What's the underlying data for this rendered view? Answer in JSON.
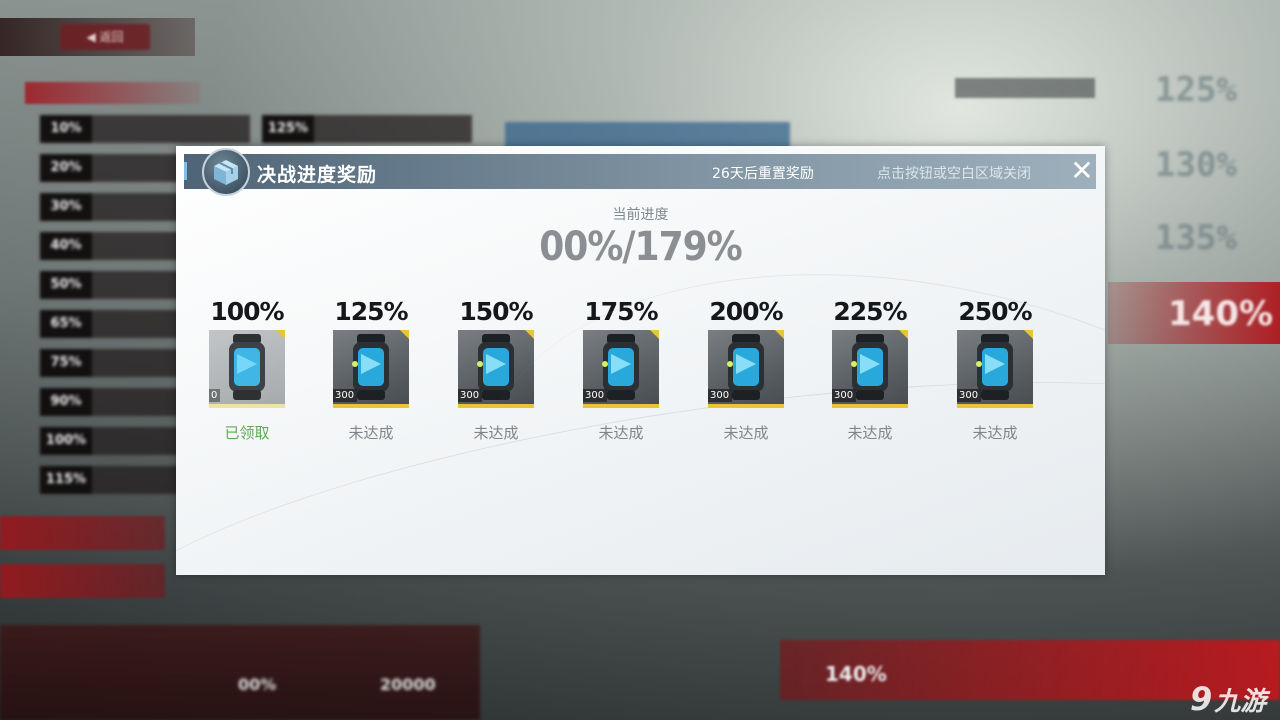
{
  "dialog": {
    "title": "决战进度奖励",
    "reset_text": "26天后重置奖励",
    "close_hint": "点击按钮或空白区域关闭",
    "close_glyph": "✕",
    "progress_label": "当前进度",
    "progress_value": "00%/179%"
  },
  "rewards": [
    {
      "percent": "100%",
      "quantity": "0",
      "status": "已领取",
      "claimed": true
    },
    {
      "percent": "125%",
      "quantity": "300",
      "status": "未达成",
      "claimed": false
    },
    {
      "percent": "150%",
      "quantity": "300",
      "status": "未达成",
      "claimed": false
    },
    {
      "percent": "175%",
      "quantity": "300",
      "status": "未达成",
      "claimed": false
    },
    {
      "percent": "200%",
      "quantity": "300",
      "status": "未达成",
      "claimed": false
    },
    {
      "percent": "225%",
      "quantity": "300",
      "status": "未达成",
      "claimed": false
    },
    {
      "percent": "250%",
      "quantity": "300",
      "status": "未达成",
      "claimed": false
    }
  ],
  "background": {
    "right_percents": [
      "125%",
      "130%",
      "135%"
    ],
    "right_active": "140%",
    "bottom_left_value_1": "00%",
    "bottom_left_value_2": "20000",
    "bottom_right_value": "140%"
  },
  "watermark": {
    "text": "九游",
    "glyph": "9"
  },
  "colors": {
    "accent_gold": "#e9c531",
    "claimed_green": "#62a957",
    "header_blue": "#4f6577",
    "bg_red": "#b01c22"
  }
}
